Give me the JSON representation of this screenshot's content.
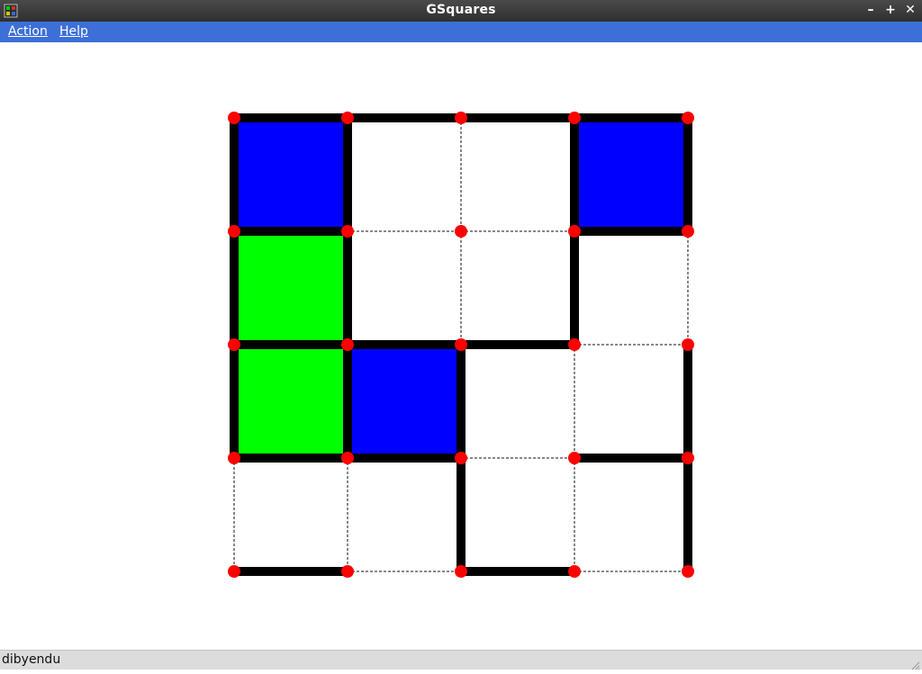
{
  "window": {
    "title": "GSquares",
    "controls": [
      {
        "name": "minimize-button",
        "glyph": "–"
      },
      {
        "name": "maximize-button",
        "glyph": "+"
      },
      {
        "name": "close-button",
        "glyph": "✕"
      }
    ]
  },
  "menu": {
    "action_label": "Action",
    "help_label": "Help"
  },
  "status": {
    "text": "dibyendu"
  },
  "colors": {
    "player_blue": "#0000ff",
    "player_green": "#00ff00",
    "dot": "#ff0000",
    "drawn_line": "#000000",
    "undrawn_line": "#888888"
  },
  "game": {
    "grid_dots": 5,
    "horizontal_lines": [
      [
        1,
        1,
        1,
        1
      ],
      [
        1,
        0,
        0,
        1
      ],
      [
        1,
        1,
        1,
        0
      ],
      [
        1,
        1,
        0,
        1
      ],
      [
        1,
        0,
        1,
        0
      ]
    ],
    "vertical_lines": [
      [
        1,
        1,
        0,
        1,
        1
      ],
      [
        1,
        1,
        0,
        1,
        0
      ],
      [
        1,
        1,
        1,
        0,
        1
      ],
      [
        0,
        0,
        1,
        0,
        1
      ]
    ],
    "boxes": [
      [
        "blue",
        "",
        "",
        "blue"
      ],
      [
        "green",
        "",
        "",
        ""
      ],
      [
        "green",
        "blue",
        "",
        ""
      ],
      [
        "",
        "",
        "",
        ""
      ]
    ]
  }
}
